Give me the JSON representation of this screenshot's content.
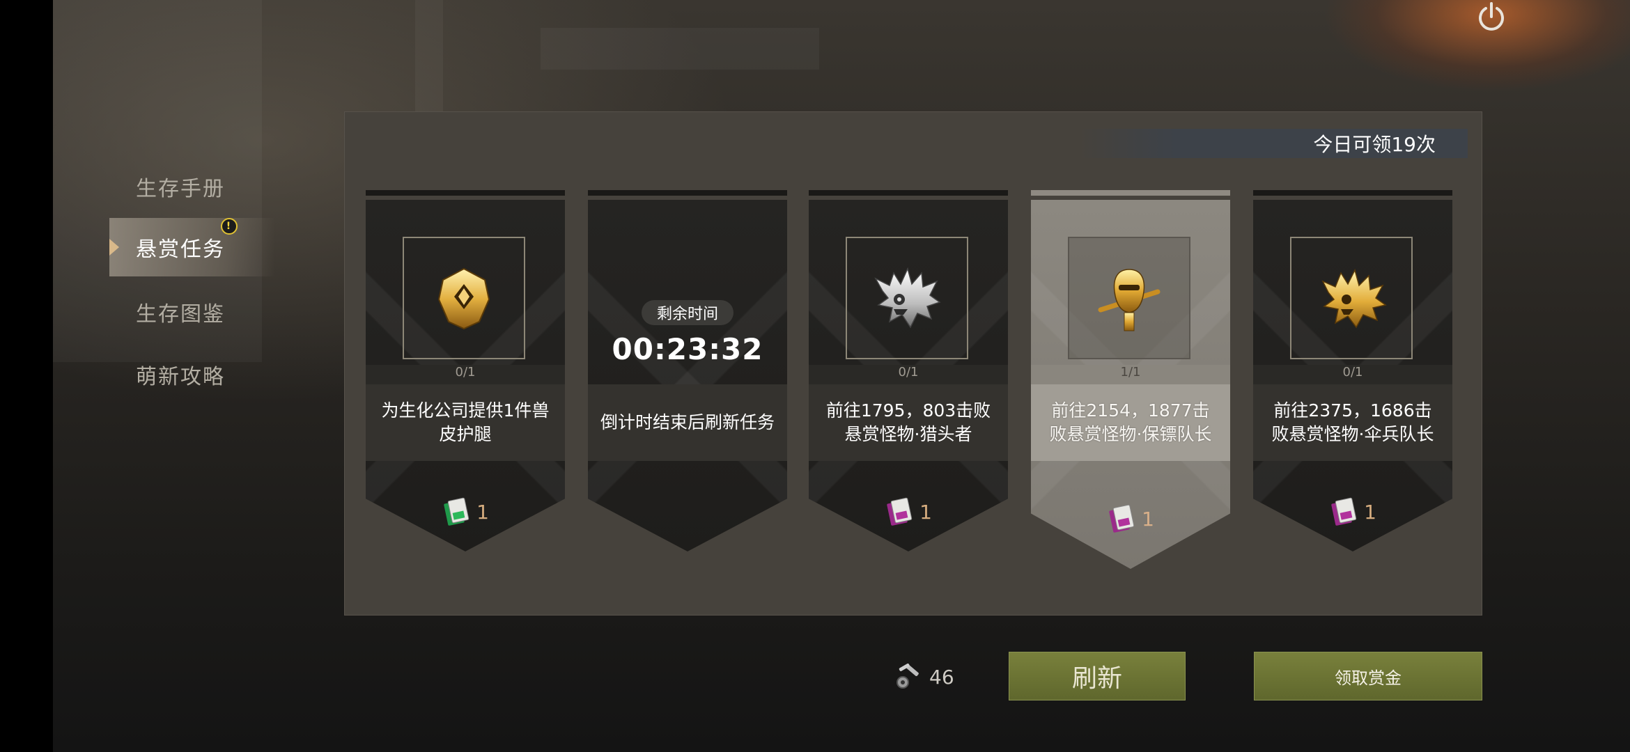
{
  "sidebar": {
    "items": [
      {
        "label": "生存手册",
        "active": false
      },
      {
        "label": "悬赏任务",
        "active": true,
        "badge": "!"
      },
      {
        "label": "生存图鉴",
        "active": false
      },
      {
        "label": "萌新攻略",
        "active": false
      }
    ]
  },
  "panel": {
    "daily_claims": "今日可领19次",
    "cards": [
      {
        "icon": "gold-armor-icon",
        "progress": "0/1",
        "description": "为生化公司提供1件兽皮护腿",
        "reward_icon": "green-card-icon",
        "reward_count": "1"
      },
      {
        "timer_label": "剩余时间",
        "timer_value": "00:23:32",
        "description": "倒计时结束后刷新任务"
      },
      {
        "icon": "silver-beast-icon",
        "progress": "0/1",
        "description": "前往1795，803击败悬赏怪物·猎头者",
        "reward_icon": "purple-card-icon",
        "reward_count": "1"
      },
      {
        "icon": "gold-bodyguard-icon",
        "progress": "1/1",
        "description": "前往2154，1877击败悬赏怪物·保镖队长",
        "reward_icon": "purple-card-icon",
        "reward_count": "1",
        "selected": true
      },
      {
        "icon": "gold-paratrooper-icon",
        "progress": "0/1",
        "description": "前往2375，1686击败悬赏怪物·伞兵队长",
        "reward_icon": "purple-card-icon",
        "reward_count": "1"
      }
    ]
  },
  "footer": {
    "currency_icon": "wrench-tool-icon",
    "currency_count": "46",
    "refresh_label": "刷新",
    "claim_label": "领取赏金"
  },
  "colors": {
    "accent_olive": "#6c7434",
    "reward_text": "#d6ad7f",
    "badge_yellow": "#e1c233"
  }
}
